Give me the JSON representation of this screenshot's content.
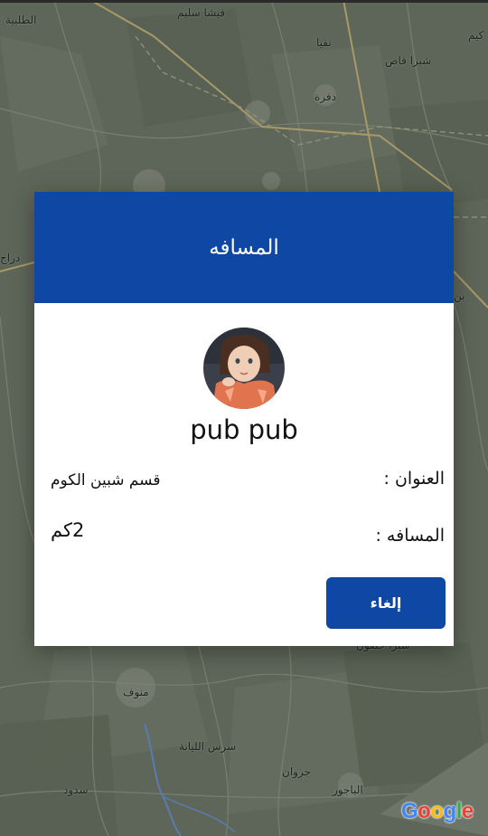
{
  "map": {
    "labels": [
      {
        "text": "الطلبية"
      },
      {
        "text": "فيشا سليم"
      },
      {
        "text": "نفيا"
      },
      {
        "text": "شبرا قاص"
      },
      {
        "text": "كيم"
      },
      {
        "text": "دفرة"
      },
      {
        "text": "دراج"
      },
      {
        "text": "بن"
      },
      {
        "text": "شبرا خلفون"
      },
      {
        "text": "منوف"
      },
      {
        "text": "سرس الليانة"
      },
      {
        "text": "جروان"
      },
      {
        "text": "سدود"
      },
      {
        "text": "الباجور"
      }
    ],
    "attribution": {
      "letters": [
        "G",
        "o",
        "o",
        "g",
        "l",
        "e"
      ],
      "colors": [
        "#4285F4",
        "#EA4335",
        "#FBBC05",
        "#4285F4",
        "#34A853",
        "#EA4335"
      ]
    }
  },
  "dialog": {
    "title": "المسافه",
    "user_name": "pub pub",
    "address_label": "العنوان :",
    "address_value": "قسم شبين الكوم",
    "distance_label": "المسافه :",
    "distance_value": "2كم",
    "cancel_label": "إلغاء"
  },
  "colors": {
    "accent": "#0f47a5",
    "map_bg": "#5e6659"
  }
}
